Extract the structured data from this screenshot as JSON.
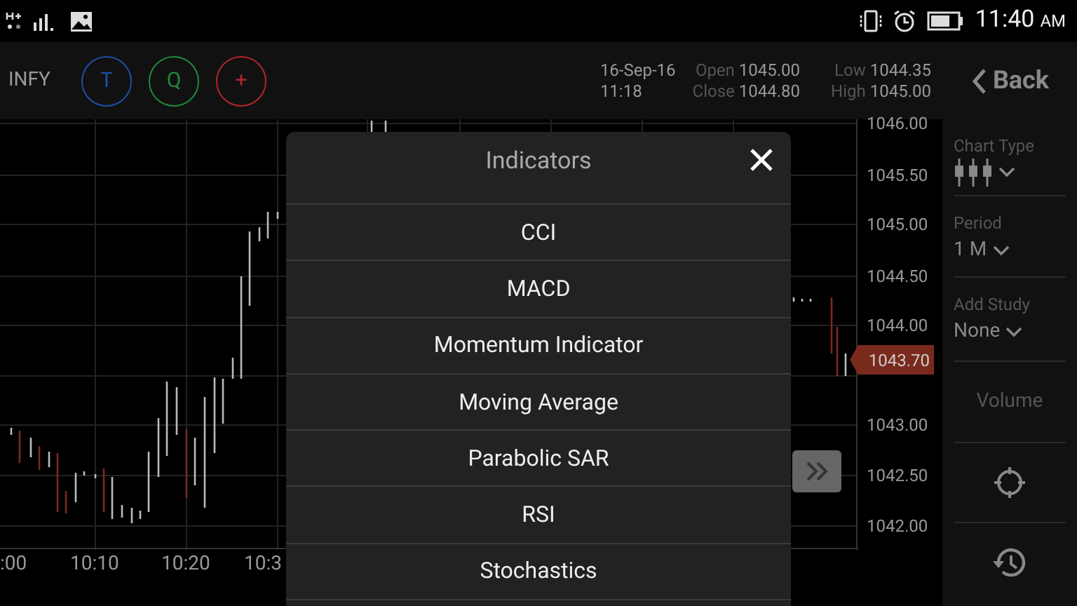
{
  "status_bar": {
    "time": "11:40",
    "meridiem": "AM"
  },
  "toolbar": {
    "symbol": "INFY",
    "buttons": [
      {
        "label": "T",
        "color": "#1e4fa8"
      },
      {
        "label": "Q",
        "color": "#1f8a3e"
      },
      {
        "label": "+",
        "color": "#b3252b"
      }
    ],
    "date": "16-Sep-16",
    "time": "11:18",
    "quotes": [
      {
        "label": "Open",
        "value": "1045.00"
      },
      {
        "label": "Low",
        "value": "1044.35"
      },
      {
        "label": "Close",
        "value": "1044.80"
      },
      {
        "label": "High",
        "value": "1045.00"
      }
    ],
    "back": "Back"
  },
  "chart": {
    "y_labels": [
      "1046.00",
      "1045.50",
      "1045.00",
      "1044.50",
      "1044.00",
      "1043.00",
      "1042.50",
      "1042.00"
    ],
    "x_labels": [
      ":00",
      "10:10",
      "10:20",
      "10:3"
    ],
    "price_tag": "1043.70"
  },
  "sidebar": {
    "chart_type_label": "Chart Type",
    "period_label": "Period",
    "period_value": "1 M",
    "study_label": "Add Study",
    "study_value": "None",
    "volume": "Volume"
  },
  "dialog": {
    "title": "Indicators",
    "items": [
      "CCI",
      "MACD",
      "Momentum Indicator",
      "Moving Average",
      "Parabolic SAR",
      "RSI",
      "Stochastics"
    ]
  }
}
